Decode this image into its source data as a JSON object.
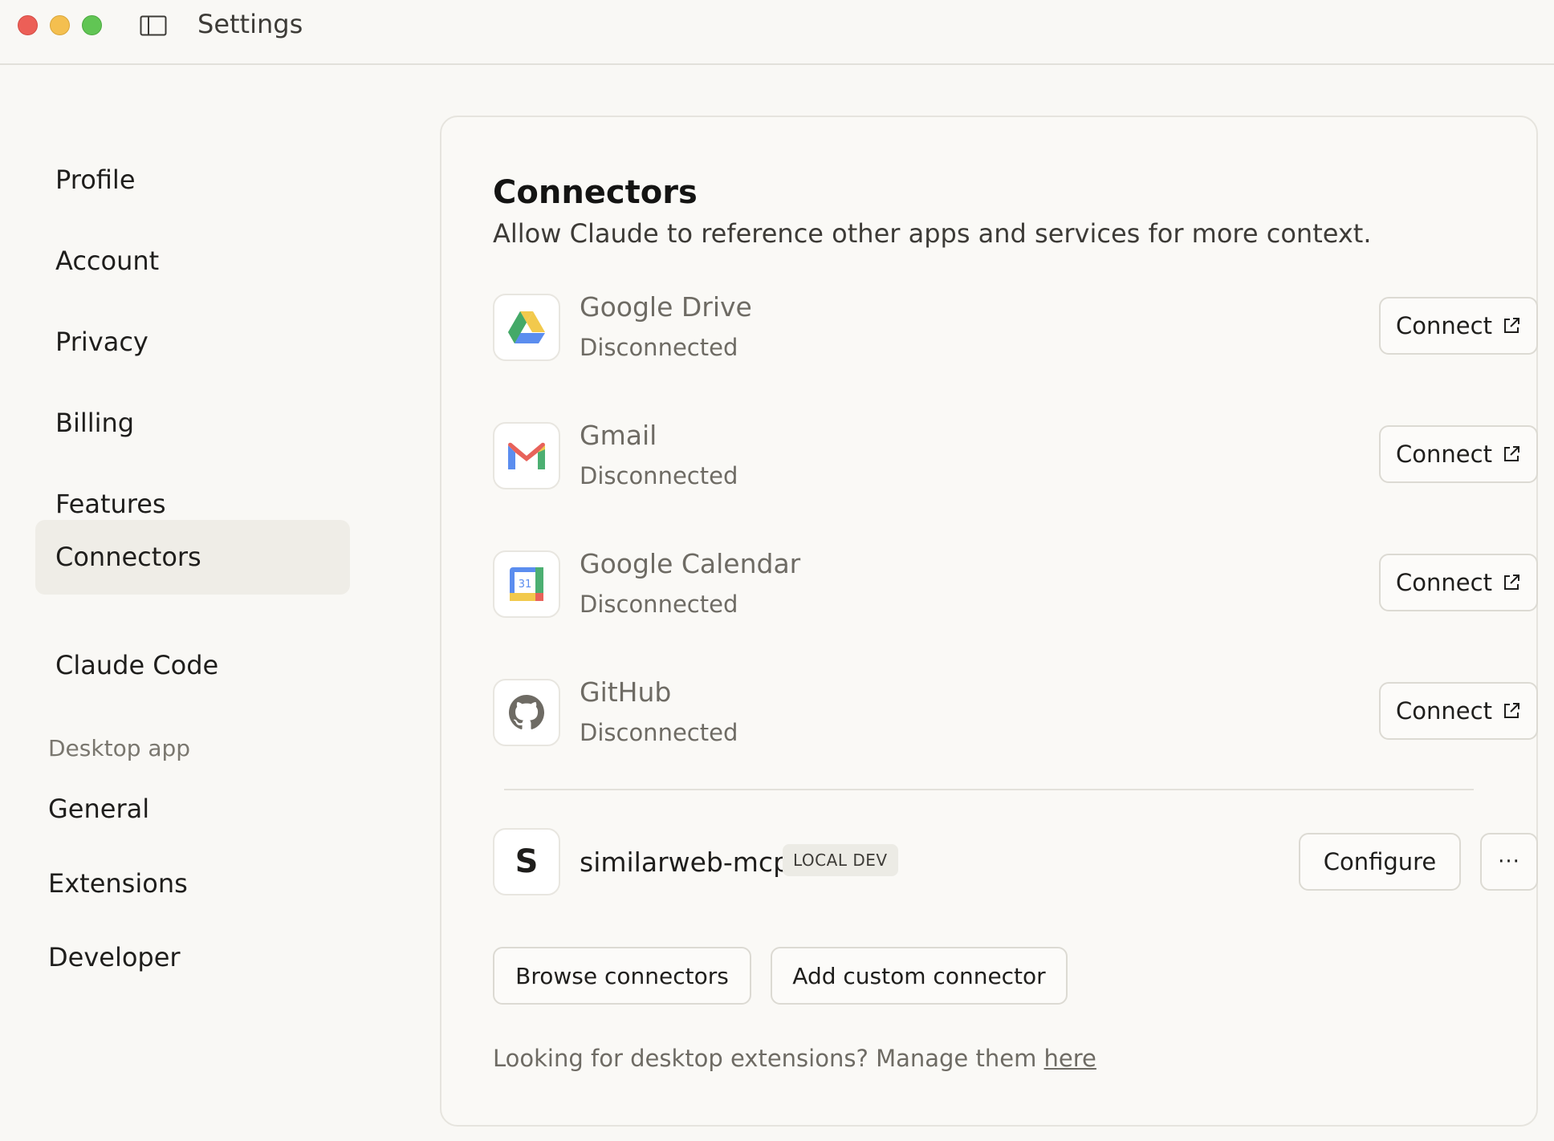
{
  "window": {
    "title": "Settings"
  },
  "nav": {
    "items": [
      {
        "label": "Profile"
      },
      {
        "label": "Account"
      },
      {
        "label": "Privacy"
      },
      {
        "label": "Billing"
      },
      {
        "label": "Features"
      },
      {
        "label": "Connectors",
        "active": true
      },
      {
        "label": "Claude Code"
      }
    ],
    "desktop_section": "Desktop app",
    "desktop_items": [
      {
        "label": "General"
      },
      {
        "label": "Extensions"
      },
      {
        "label": "Developer"
      }
    ]
  },
  "main": {
    "title": "Connectors",
    "subtitle": "Allow Claude to reference other apps and services for more context.",
    "connectors": [
      {
        "name": "Google Drive",
        "status": "Disconnected",
        "icon": "google-drive-icon",
        "button": "Connect"
      },
      {
        "name": "Gmail",
        "status": "Disconnected",
        "icon": "gmail-icon",
        "button": "Connect"
      },
      {
        "name": "Google Calendar",
        "status": "Disconnected",
        "icon": "google-calendar-icon",
        "button": "Connect"
      },
      {
        "name": "GitHub",
        "status": "Disconnected",
        "icon": "github-icon",
        "button": "Connect"
      }
    ],
    "calendar_day": "31",
    "local": {
      "letter": "S",
      "name": "similarweb-mcp",
      "badge": "LOCAL DEV",
      "configure": "Configure",
      "more": "···"
    },
    "browse_button": "Browse connectors",
    "custom_button": "Add custom connector",
    "footnote_prefix": "Looking for desktop extensions? Manage them ",
    "footnote_link": "here"
  },
  "colors": {
    "background": "#f9f8f5",
    "active_nav": "#efede7",
    "muted_text": "#6e6b64"
  }
}
